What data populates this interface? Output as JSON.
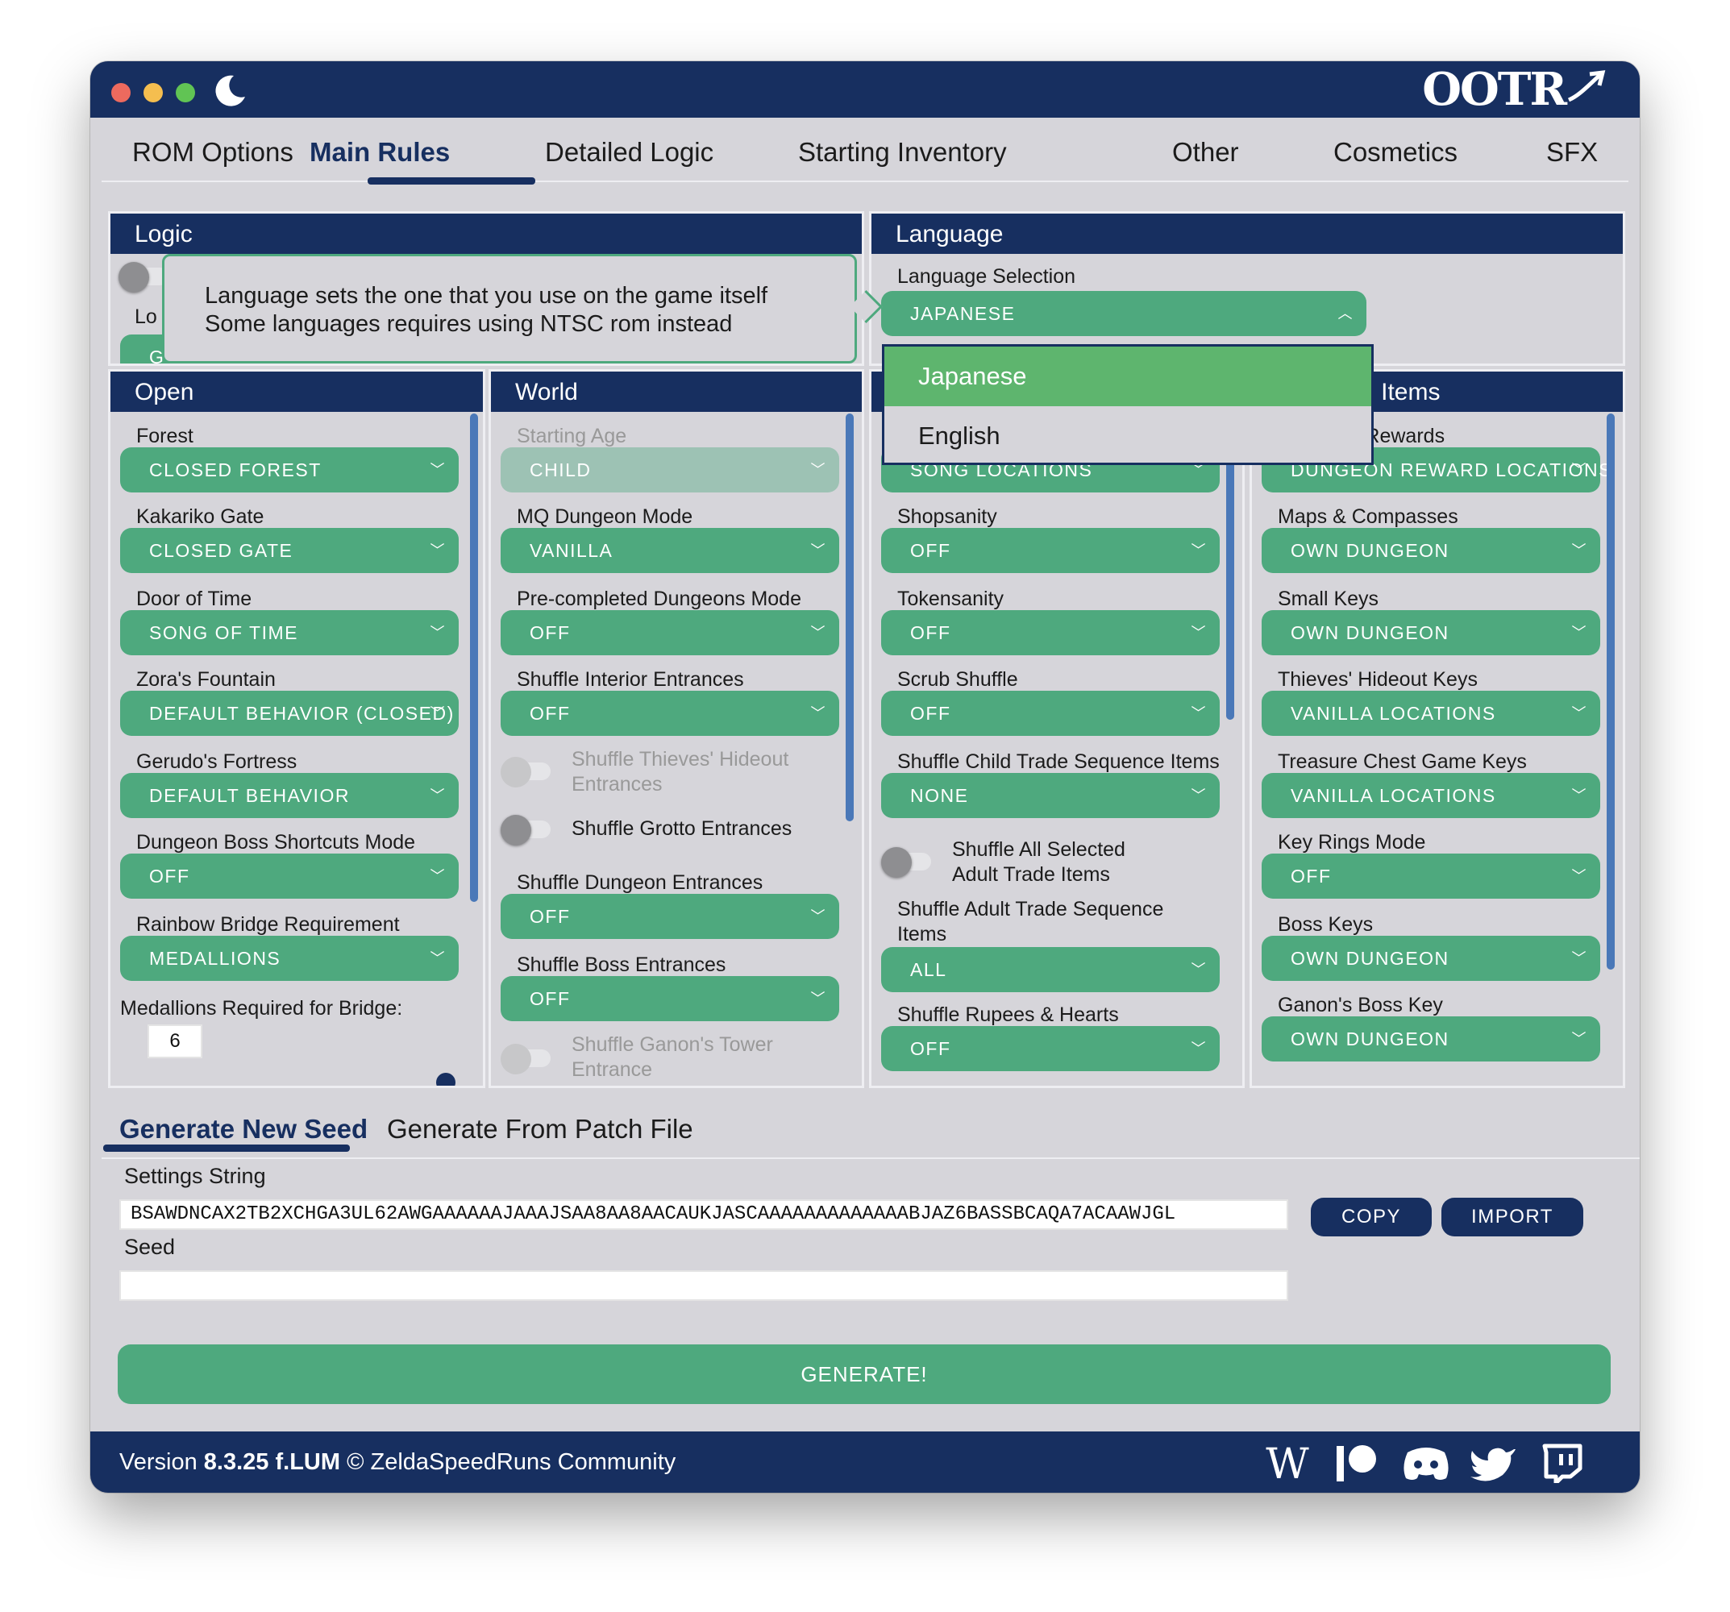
{
  "window": {
    "logo": "OOTR"
  },
  "tabs": [
    "ROM Options",
    "Main Rules",
    "Detailed Logic",
    "Starting Inventory",
    "Other",
    "Cosmetics",
    "SFX"
  ],
  "logic_panel": {
    "title": "Logic",
    "field_label_partial": "Lo",
    "select_partial": "G"
  },
  "tooltip": {
    "line1": "Language sets the one that you use on the game itself",
    "line2": "Some languages requires using NTSC rom instead"
  },
  "language_panel": {
    "title": "Language",
    "field_label": "Language Selection",
    "value": "JAPANESE",
    "options": [
      "Japanese",
      "English"
    ]
  },
  "open_panel": {
    "title": "Open",
    "fields": [
      {
        "label": "Forest",
        "value": "CLOSED FOREST"
      },
      {
        "label": "Kakariko Gate",
        "value": "CLOSED GATE"
      },
      {
        "label": "Door of Time",
        "value": "SONG OF TIME"
      },
      {
        "label": "Zora's Fountain",
        "value": "DEFAULT BEHAVIOR (CLOSED)"
      },
      {
        "label": "Gerudo's Fortress",
        "value": "DEFAULT BEHAVIOR"
      },
      {
        "label": "Dungeon Boss Shortcuts Mode",
        "value": "OFF"
      },
      {
        "label": "Rainbow Bridge Requirement",
        "value": "MEDALLIONS"
      }
    ],
    "medallions_label": "Medallions Required for Bridge:",
    "medallions_value": "6"
  },
  "world_panel": {
    "title": "World",
    "starting_age_label": "Starting Age",
    "starting_age_value": "CHILD",
    "fields": [
      {
        "label": "MQ Dungeon Mode",
        "value": "VANILLA"
      },
      {
        "label": "Pre-completed Dungeons Mode",
        "value": "OFF"
      },
      {
        "label": "Shuffle Interior Entrances",
        "value": "OFF"
      }
    ],
    "toggle_thieves_line1": "Shuffle Thieves' Hideout",
    "toggle_thieves_line2": "Entrances",
    "toggle_grotto": "Shuffle Grotto Entrances",
    "fields2": [
      {
        "label": "Shuffle Dungeon Entrances",
        "value": "OFF"
      },
      {
        "label": "Shuffle Boss Entrances",
        "value": "OFF"
      }
    ],
    "toggle_ganon_line1": "Shuffle Ganon's Tower",
    "toggle_ganon_line2": "Entrance"
  },
  "shuffle_panel": {
    "partial_select": "SONG LOCATIONS",
    "fields": [
      {
        "label": "Shopsanity",
        "value": "OFF"
      },
      {
        "label": "Tokensanity",
        "value": "OFF"
      },
      {
        "label": "Scrub Shuffle",
        "value": "OFF"
      },
      {
        "label": "Shuffle Child Trade Sequence Items",
        "value": "NONE"
      }
    ],
    "toggle_adult_line1": "Shuffle All Selected",
    "toggle_adult_line2": "Adult Trade Items",
    "adult_trade_label_line1": "Shuffle Adult Trade Sequence",
    "adult_trade_label_line2": "Items",
    "adult_trade_value": "ALL",
    "rupees_label": "Shuffle Rupees & Hearts",
    "rupees_value": "OFF"
  },
  "dungeon_panel": {
    "title_partial": "Dungeon Items",
    "rewards_label_partial": "Dungeon Rewards",
    "rewards_value_partial": "DUNGEON REWARD LOCATIONS",
    "fields": [
      {
        "label": "Maps & Compasses",
        "value": "OWN DUNGEON"
      },
      {
        "label": "Small Keys",
        "value": "OWN DUNGEON"
      },
      {
        "label": "Thieves' Hideout Keys",
        "value": "VANILLA LOCATIONS"
      },
      {
        "label": "Treasure Chest Game Keys",
        "value": "VANILLA LOCATIONS"
      },
      {
        "label": "Key Rings Mode",
        "value": "OFF"
      },
      {
        "label": "Boss Keys",
        "value": "OWN DUNGEON"
      },
      {
        "label": "Ganon's Boss Key",
        "value": "OWN DUNGEON"
      }
    ]
  },
  "generator": {
    "tabs": [
      "Generate New Seed",
      "Generate From Patch File"
    ],
    "settings_label": "Settings String",
    "settings_value": "BSAWDNCAX2TB2XCHGA3UL62AWGAAAAAAJAAAJSAA8AA8AACAUKJASCAAAAAAAAAAAAABJAZ6BASSBCAQA7ACAAWJGL",
    "copy_label": "COPY",
    "import_label": "IMPORT",
    "seed_label": "Seed",
    "seed_value": "",
    "generate_label": "GENERATE!"
  },
  "footer": {
    "version_prefix": "Version ",
    "version": "8.3.25 f.LUM",
    "copyright": "© ZeldaSpeedRuns Community",
    "icons": [
      "wikipedia-icon",
      "patreon-icon",
      "discord-icon",
      "twitter-icon",
      "twitch-icon"
    ]
  },
  "colors": {
    "navy": "#172f60",
    "green": "#4ea97e",
    "selected_option": "#5eb56e",
    "panel_bg": "#d6d5da"
  }
}
